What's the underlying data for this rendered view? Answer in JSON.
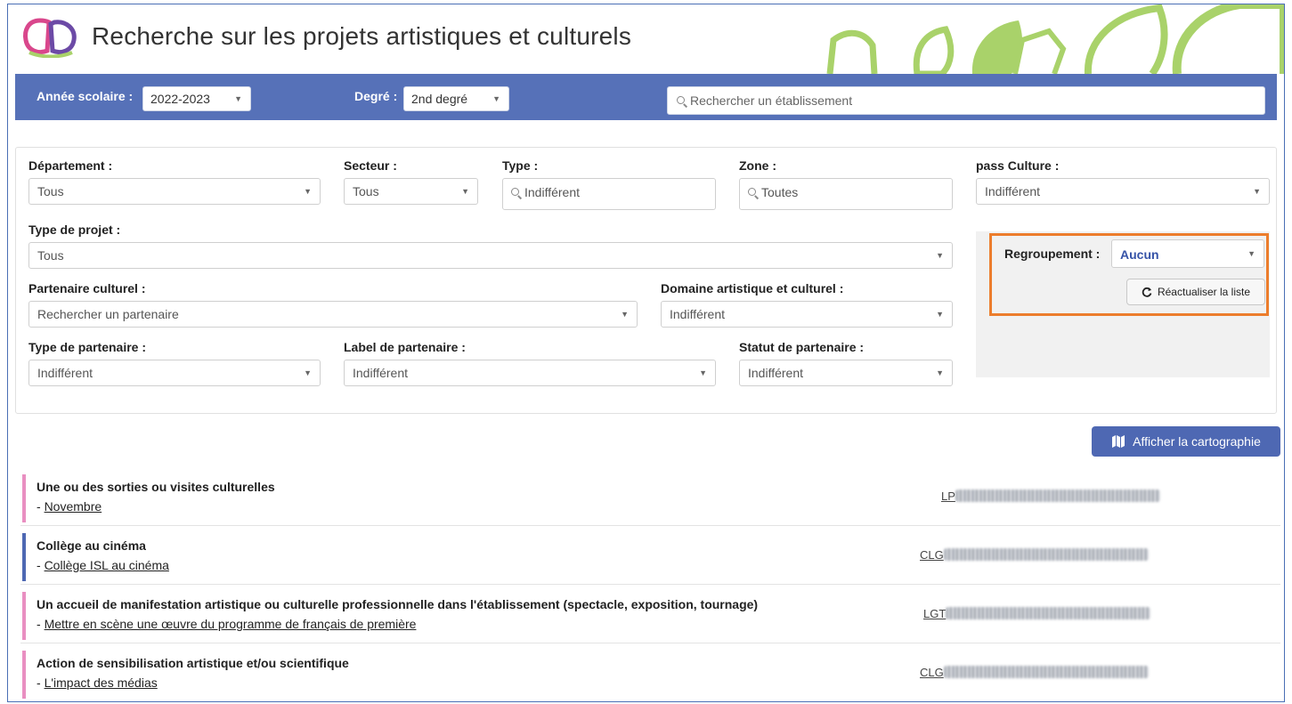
{
  "header": {
    "title": "Recherche sur les projets artistiques et culturels"
  },
  "toolbar": {
    "year_label": "Année scolaire :",
    "year_value": "2022-2023",
    "degree_label": "Degré :",
    "degree_value": "2nd degré",
    "search_placeholder": "Rechercher un établissement"
  },
  "filters": {
    "departement": {
      "label": "Département :",
      "value": "Tous"
    },
    "secteur": {
      "label": "Secteur :",
      "value": "Tous"
    },
    "type": {
      "label": "Type :",
      "value": "Indifférent"
    },
    "zone": {
      "label": "Zone :",
      "value": "Toutes"
    },
    "pass_culture": {
      "label": "pass Culture :",
      "value": "Indifférent"
    },
    "type_projet": {
      "label": "Type de projet :",
      "value": "Tous"
    },
    "partenaire": {
      "label": "Partenaire culturel :",
      "placeholder": "Rechercher un partenaire"
    },
    "domaine": {
      "label": "Domaine artistique et culturel :",
      "value": "Indifférent"
    },
    "type_partenaire": {
      "label": "Type de partenaire :",
      "value": "Indifférent"
    },
    "label_partenaire": {
      "label": "Label de partenaire :",
      "value": "Indifférent"
    },
    "statut_partenaire": {
      "label": "Statut de partenaire :",
      "value": "Indifférent"
    }
  },
  "grouping": {
    "label": "Regroupement :",
    "value": "Aucun",
    "refresh_label": "Réactualiser la liste",
    "highlight_color": "#ec7d2c"
  },
  "map_button": {
    "label": "Afficher la cartographie",
    "icon": "map-icon"
  },
  "results": [
    {
      "title": "Une ou des sorties ou visites culturelles",
      "subtitle": "Novembre",
      "etab_prefix": "LP",
      "color": "#e98fc1"
    },
    {
      "title": "Collège au cinéma",
      "subtitle": "Collège ISL au cinéma",
      "etab_prefix": "CLG",
      "color": "#4e68b3"
    },
    {
      "title": "Un accueil de manifestation artistique ou culturelle professionnelle dans l'établissement (spectacle, exposition, tournage)",
      "subtitle": "Mettre en scène une œuvre du programme de français de première",
      "etab_prefix": "LGT",
      "color": "#e98fc1"
    },
    {
      "title": "Action de sensibilisation artistique et/ou scientifique",
      "subtitle": "L'impact des médias",
      "etab_prefix": "CLG",
      "color": "#e98fc1"
    }
  ],
  "colors": {
    "toolbar": "#5671b8",
    "accent_green": "#a9d26a",
    "logo_pink": "#d9478c",
    "logo_purple": "#6c4aa6"
  }
}
